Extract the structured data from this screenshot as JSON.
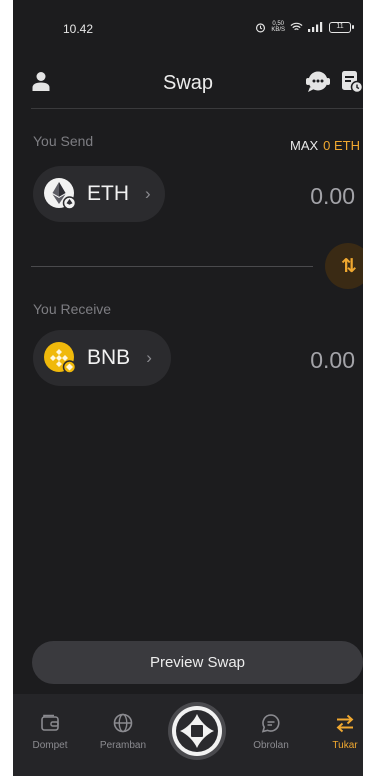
{
  "status_bar": {
    "time": "10.42",
    "net_speed_top": "0,50",
    "net_speed_bottom": "KB/S",
    "battery": "11"
  },
  "header": {
    "title": "Swap"
  },
  "send": {
    "label": "You Send",
    "max_label": "MAX",
    "max_value": "0 ETH",
    "token_symbol": "ETH",
    "token_icon": "ethereum-icon",
    "amount": "0.00"
  },
  "swap_toggle_glyph": "⇅",
  "receive": {
    "label": "You Receive",
    "token_symbol": "BNB",
    "token_icon": "bnb-icon",
    "amount": "0.00"
  },
  "preview_button": "Preview Swap",
  "bottom_nav": {
    "items": [
      {
        "label": "Dompet",
        "icon": "wallet-icon"
      },
      {
        "label": "Peramban",
        "icon": "globe-icon"
      },
      {
        "label": "",
        "icon": "center-logo-icon"
      },
      {
        "label": "Obrolan",
        "icon": "chat-icon"
      },
      {
        "label": "Tukar",
        "icon": "swap-arrows-icon"
      }
    ]
  },
  "colors": {
    "accent": "#f0a830",
    "background": "#1c1c1e",
    "pill": "#2b2b2e"
  }
}
